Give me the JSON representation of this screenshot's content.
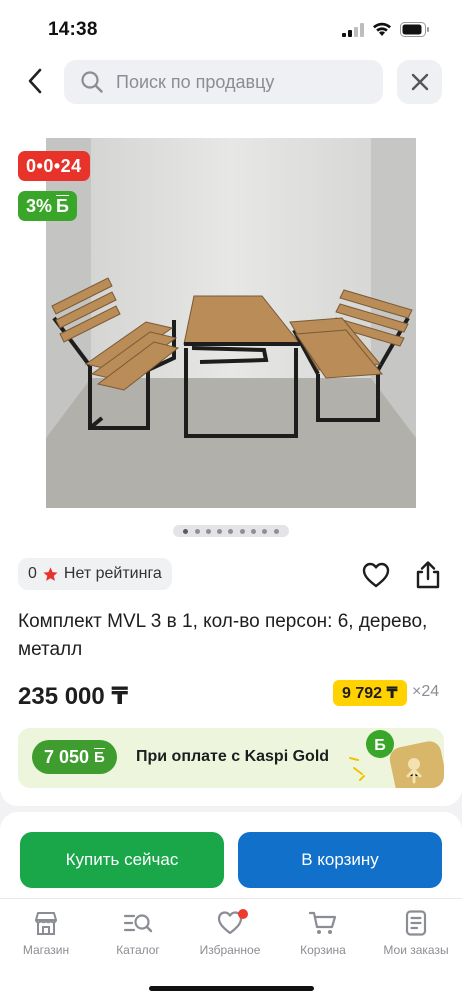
{
  "status_bar": {
    "time": "14:38"
  },
  "search": {
    "placeholder": "Поиск по продавцу"
  },
  "product": {
    "timer_badge": "0•0•24",
    "bonus_badge_percent": "3%",
    "bonus_symbol": "Б",
    "rating_value": "0",
    "rating_text": "Нет рейтинга",
    "title": "Комплект MVL 3 в 1, кол-во персон: 6, дерево, металл",
    "price": "235 000 ₸",
    "monthly_payment": "9 792 ₸",
    "months": "×24",
    "gallery_count": 9,
    "gallery_active_index": 0
  },
  "kaspi_banner": {
    "bonus_amount": "7 050",
    "bonus_symbol": "Б",
    "text": "При оплате с Kaspi Gold"
  },
  "actions": {
    "buy_now": "Купить сейчас",
    "add_to_cart": "В корзину"
  },
  "tabs": [
    {
      "label": "Магазин",
      "icon": "shop-icon"
    },
    {
      "label": "Каталог",
      "icon": "catalog-search-icon"
    },
    {
      "label": "Избранное",
      "icon": "heart-icon",
      "has_notification": true
    },
    {
      "label": "Корзина",
      "icon": "cart-icon"
    },
    {
      "label": "Мои заказы",
      "icon": "orders-icon"
    }
  ],
  "colors": {
    "timer_badge": "#e8332a",
    "bonus_green": "#3aa629",
    "buy_button": "#19a74a",
    "cart_button": "#1170c9",
    "monthly_badge": "#ffd200",
    "rating_star": "#e8332a"
  }
}
